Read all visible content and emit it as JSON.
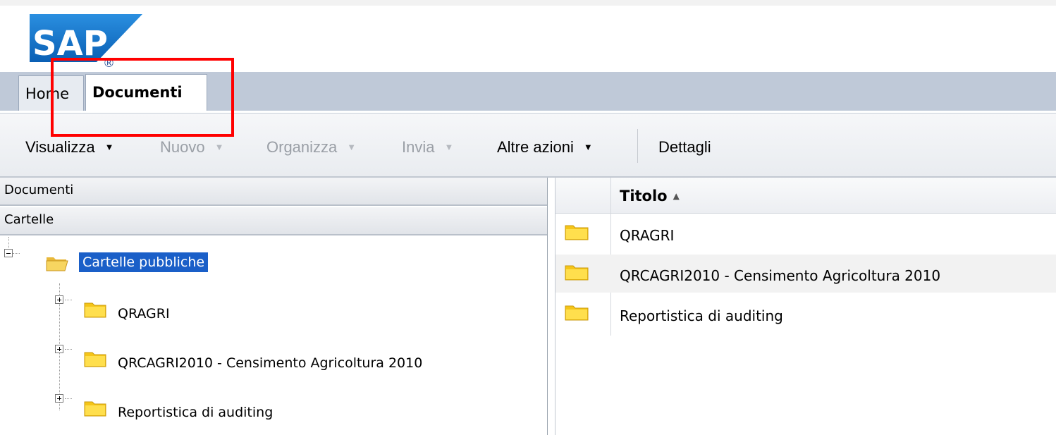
{
  "brand": {
    "logo_text": "SAP",
    "registered_mark": "®"
  },
  "tabs": [
    {
      "label": "Home",
      "active": false
    },
    {
      "label": "Documenti",
      "active": true
    }
  ],
  "toolbar": {
    "items": [
      {
        "label": "Visualizza",
        "enabled": true
      },
      {
        "label": "Nuovo",
        "enabled": false
      },
      {
        "label": "Organizza",
        "enabled": false
      },
      {
        "label": "Invia",
        "enabled": false
      },
      {
        "label": "Altre azioni",
        "enabled": true
      }
    ],
    "details_label": "Dettagli"
  },
  "left_panel": {
    "accordion": [
      "Documenti",
      "Cartelle"
    ],
    "tree": {
      "root": {
        "label": "Cartelle pubbliche",
        "expanded": true,
        "selected": true
      },
      "children": [
        {
          "label": "QRAGRI",
          "expanded": false
        },
        {
          "label": "QRCAGRI2010 - Censimento Agricoltura 2010",
          "expanded": false
        },
        {
          "label": "Reportistica di auditing",
          "expanded": false
        }
      ]
    }
  },
  "right_panel": {
    "columns": [
      {
        "label": "Titolo",
        "sort": "ascending",
        "sort_glyph": "▲"
      }
    ],
    "rows": [
      {
        "title": "QRAGRI"
      },
      {
        "title": "QRCAGRI2010 - Censimento Agricoltura 2010"
      },
      {
        "title": "Reportistica di auditing"
      }
    ]
  },
  "colors": {
    "selection": "#1a5fc8",
    "highlight_box": "#ff0000",
    "tabbar": "#bfc9d8",
    "brand_blue": "#0a6ed1"
  },
  "icons": {
    "folder": "folder-icon",
    "open_folder": "folder-open-icon",
    "dropdown": "dropdown-arrow-icon"
  }
}
